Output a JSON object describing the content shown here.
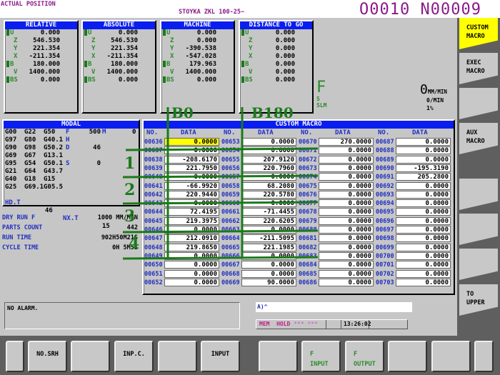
{
  "header": {
    "screen_title": "ACTUAL POSITION",
    "program_name": "STOYKA ZKL 100-25~",
    "program_number": "O0010 N00009"
  },
  "positions": [
    {
      "title": "RELATIVE",
      "axes": [
        {
          "a": "U",
          "v": "0.000"
        },
        {
          "a": "Z",
          "v": "546.530"
        },
        {
          "a": "Y",
          "v": "221.354"
        },
        {
          "a": "X",
          "v": "-211.354"
        },
        {
          "a": "B",
          "v": "180.000"
        },
        {
          "a": "V",
          "v": "1400.000"
        },
        {
          "a": "BS",
          "v": "0.000"
        }
      ]
    },
    {
      "title": "ABSOLUTE",
      "axes": [
        {
          "a": "U",
          "v": "0.000"
        },
        {
          "a": "Z",
          "v": "546.530"
        },
        {
          "a": "Y",
          "v": "221.354"
        },
        {
          "a": "X",
          "v": "-211.354"
        },
        {
          "a": "B",
          "v": "180.000"
        },
        {
          "a": "V",
          "v": "1400.000"
        },
        {
          "a": "BS",
          "v": "0.000"
        }
      ]
    },
    {
      "title": "MACHINE",
      "axes": [
        {
          "a": "U",
          "v": "0.000"
        },
        {
          "a": "Z",
          "v": "0.000"
        },
        {
          "a": "Y",
          "v": "-390.538"
        },
        {
          "a": "X",
          "v": "-547.028"
        },
        {
          "a": "B",
          "v": "179.963"
        },
        {
          "a": "V",
          "v": "1400.000"
        },
        {
          "a": "BS",
          "v": "0.000"
        }
      ]
    },
    {
      "title": "DISTANCE TO GO",
      "axes": [
        {
          "a": "U",
          "v": "0.000"
        },
        {
          "a": "Z",
          "v": "0.000"
        },
        {
          "a": "Y",
          "v": "0.000"
        },
        {
          "a": "X",
          "v": "0.000"
        },
        {
          "a": "B",
          "v": "0.000"
        },
        {
          "a": "V",
          "v": "0.000"
        },
        {
          "a": "BS",
          "v": "0.000"
        }
      ]
    }
  ],
  "feed": {
    "f_label": "F",
    "s_label": "S",
    "slm_label": "SLM",
    "feed_value": "0",
    "feed_unit": "MM/MIN",
    "spindle": "0/MIN",
    "override": "1%"
  },
  "modal": {
    "title": "MODAL",
    "rows": [
      [
        "G00",
        "G22",
        "G50",
        "F",
        "500",
        "M",
        "0"
      ],
      [
        "G97",
        "G80",
        "G40.1",
        "H",
        "",
        "",
        ""
      ],
      [
        "G90",
        "G98",
        "G50.2",
        "D",
        "46",
        "",
        ""
      ],
      [
        "G69",
        "G67",
        "G13.1",
        "",
        "",
        "",
        ""
      ],
      [
        "G95",
        "G54",
        "G50.1",
        "S",
        "0",
        "",
        ""
      ],
      [
        "G21",
        "G64",
        "G43.7",
        "",
        "",
        "",
        ""
      ],
      [
        "G40",
        "G18",
        "G15",
        "",
        "",
        "",
        ""
      ],
      [
        "G25",
        "G69.1",
        "G05.5",
        "",
        "",
        "",
        ""
      ]
    ],
    "hd_t_label": "HD.T",
    "hd_t": "46",
    "nx_t_label": "NX.T",
    "nx_t": "15"
  },
  "status_info": [
    {
      "label": "DRY RUN F",
      "value": "1000 MM/MIN"
    },
    {
      "label": "PARTS COUNT",
      "value": "442"
    },
    {
      "label": "RUN TIME",
      "value": "902H50M21S"
    },
    {
      "label": "CYCLE TIME",
      "value": "0H 5M5S"
    }
  ],
  "macro": {
    "title": "CUSTOM MACRO",
    "no_header": "NO.",
    "data_header": "DATA",
    "selected": "00636",
    "columns": [
      {
        "nos": [
          "00636",
          "00637",
          "00638",
          "00639",
          "00640",
          "00641",
          "00642",
          "00643",
          "00644",
          "00645",
          "00646",
          "00647",
          "00648",
          "00649",
          "00650",
          "00651",
          "00652"
        ],
        "values": [
          "0.0000",
          "0.0000",
          "-208.6170",
          "221.7950",
          "0.0000",
          "-66.9920",
          "220.9440",
          "0.0000",
          "72.4195",
          "219.3975",
          "0.0000",
          "212.0910",
          "219.8650",
          "0.0000",
          "0.0000",
          "0.0000",
          "0.0000"
        ]
      },
      {
        "nos": [
          "00653",
          "00654",
          "00655",
          "00656",
          "00657",
          "00658",
          "00659",
          "00660",
          "00661",
          "00662",
          "00663",
          "00664",
          "00665",
          "00666",
          "00667",
          "00668",
          "00669"
        ],
        "values": [
          "0.0000",
          "0.0000",
          "207.9120",
          "220.7960",
          "0.0000",
          "68.2080",
          "220.5780",
          "0.0000",
          "-71.4455",
          "220.6205",
          "0.0000",
          "-211.5095",
          "221.1985",
          "0.0000",
          "0.0000",
          "0.0000",
          "90.0000"
        ]
      },
      {
        "nos": [
          "00670",
          "00671",
          "00672",
          "00673",
          "00674",
          "00675",
          "00676",
          "00677",
          "00678",
          "00679",
          "00680",
          "00681",
          "00682",
          "00683",
          "00684",
          "00685",
          "00686"
        ],
        "values": [
          "270.0000",
          "0.0000",
          "0.0000",
          "0.0000",
          "0.0000",
          "0.0000",
          "0.0000",
          "0.0000",
          "0.0000",
          "0.0000",
          "0.0000",
          "0.0000",
          "0.0000",
          "0.0000",
          "0.0000",
          "0.0000",
          "0.0000"
        ]
      },
      {
        "nos": [
          "00687",
          "00688",
          "00689",
          "00690",
          "00691",
          "00692",
          "00693",
          "00694",
          "00695",
          "00696",
          "00697",
          "00698",
          "00699",
          "00700",
          "00701",
          "00702",
          "00703"
        ],
        "values": [
          "0.0000",
          "0.0000",
          "0.0000",
          "-195.3190",
          "205.2800",
          "0.0000",
          "0.0000",
          "0.0000",
          "0.0000",
          "0.0000",
          "0.0000",
          "0.0000",
          "0.0000",
          "0.0000",
          "0.0000",
          "0.0000",
          "0.0000"
        ]
      }
    ]
  },
  "alarm": "NO ALARM.",
  "input_line": "A)^",
  "status_bar": {
    "mode": "MEM",
    "state": "HOLD",
    "stars1": "***",
    "stars2": "***",
    "time": "13:26:02"
  },
  "right_softkeys": [
    [
      "CUSTOM",
      "MACRO"
    ],
    [
      "EXEC",
      "MACRO"
    ],
    [
      "",
      ""
    ],
    [
      "AUX",
      "MACRO"
    ],
    [
      "",
      ""
    ],
    [
      "",
      ""
    ],
    [
      "",
      ""
    ],
    [
      "TO",
      "UPPER"
    ]
  ],
  "bottom_softkeys": [
    [
      "",
      ""
    ],
    [
      "NO.SRH",
      ""
    ],
    [
      "",
      ""
    ],
    [
      "INP.C.",
      ""
    ],
    [
      "",
      ""
    ],
    [
      "INPUT",
      ""
    ],
    [
      "",
      ""
    ],
    [
      "F",
      "INPUT"
    ],
    [
      "F",
      "OUTPUT"
    ],
    [
      "",
      ""
    ],
    [
      "",
      ""
    ],
    [
      "",
      ""
    ]
  ],
  "annotations": {
    "b0": "B0",
    "b180": "B180",
    "marks": [
      "1",
      "2",
      "3",
      "4"
    ]
  },
  "colors": {
    "accent_blue": "#0a1ef0",
    "highlight": "#ffff00",
    "annotation_green": "#1a7a1a",
    "title_purple": "#8a1a8a"
  }
}
